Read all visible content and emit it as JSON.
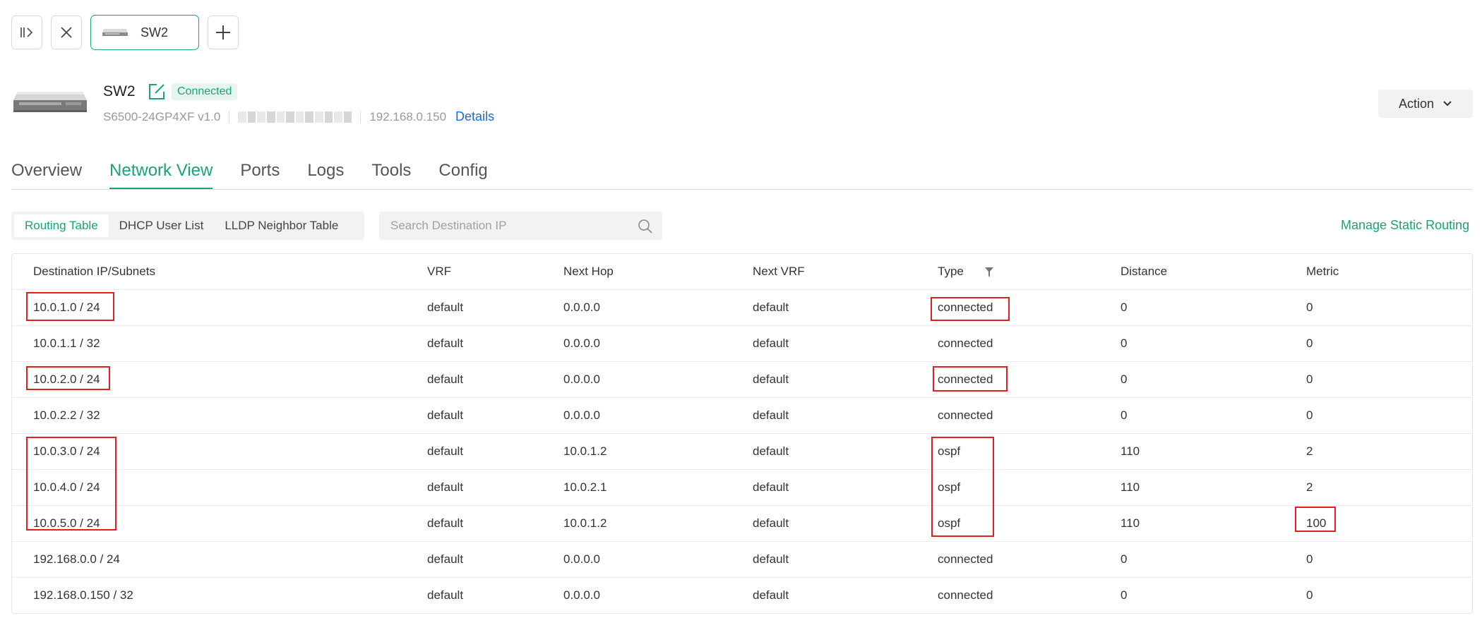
{
  "tab": {
    "device_name": "SW2"
  },
  "device": {
    "name": "SW2",
    "status": "Connected",
    "model": "S6500-24GP4XF v1.0",
    "ip": "192.168.0.150",
    "details_label": "Details",
    "action_label": "Action"
  },
  "main_tabs": [
    "Overview",
    "Network View",
    "Ports",
    "Logs",
    "Tools",
    "Config"
  ],
  "sub_tabs": [
    "Routing Table",
    "DHCP User List",
    "LLDP Neighbor Table"
  ],
  "search": {
    "placeholder": "Search Destination IP"
  },
  "manage_label": "Manage Static Routing",
  "table": {
    "headers": [
      "Destination IP/Subnets",
      "VRF",
      "Next Hop",
      "Next VRF",
      "Type",
      "Distance",
      "Metric"
    ],
    "rows": [
      [
        "10.0.1.0 / 24",
        "default",
        "0.0.0.0",
        "default",
        "connected",
        "0",
        "0"
      ],
      [
        "10.0.1.1 / 32",
        "default",
        "0.0.0.0",
        "default",
        "connected",
        "0",
        "0"
      ],
      [
        "10.0.2.0 / 24",
        "default",
        "0.0.0.0",
        "default",
        "connected",
        "0",
        "0"
      ],
      [
        "10.0.2.2 / 32",
        "default",
        "0.0.0.0",
        "default",
        "connected",
        "0",
        "0"
      ],
      [
        "10.0.3.0 / 24",
        "default",
        "10.0.1.2",
        "default",
        "ospf",
        "110",
        "2"
      ],
      [
        "10.0.4.0 / 24",
        "default",
        "10.0.2.1",
        "default",
        "ospf",
        "110",
        "2"
      ],
      [
        "10.0.5.0 / 24",
        "default",
        "10.0.1.2",
        "default",
        "ospf",
        "110",
        "100"
      ],
      [
        "192.168.0.0 / 24",
        "default",
        "0.0.0.0",
        "default",
        "connected",
        "0",
        "0"
      ],
      [
        "192.168.0.150 / 32",
        "default",
        "0.0.0.0",
        "default",
        "connected",
        "0",
        "0"
      ]
    ]
  },
  "colors": {
    "accent": "#1aa37a",
    "link": "#1c6bd1",
    "highlight": "#e02020"
  }
}
